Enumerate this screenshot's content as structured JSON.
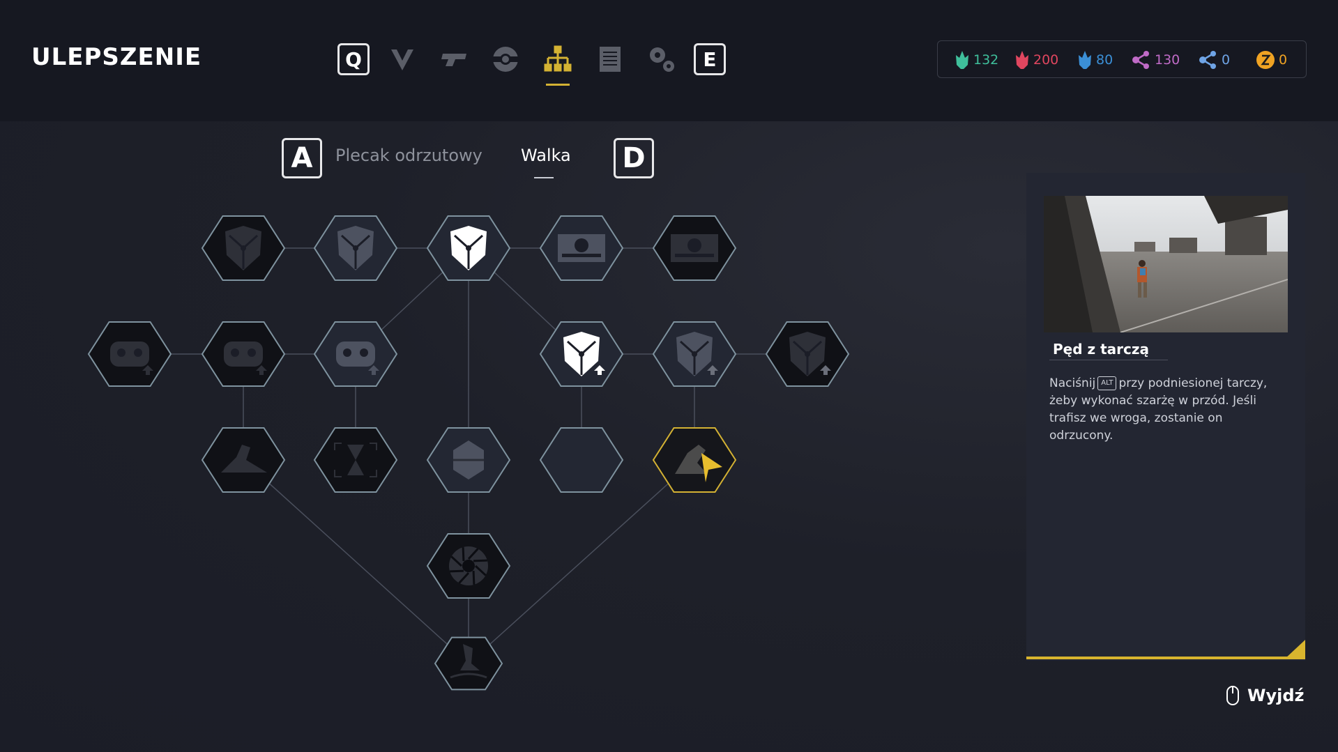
{
  "header": {
    "title": "ULEPSZENIE",
    "key_prev": "Q",
    "key_next": "E",
    "nav_icons": [
      {
        "name": "chevron-emblem-icon",
        "active": false
      },
      {
        "name": "weapon-icon",
        "active": false
      },
      {
        "name": "gear-part-icon",
        "active": false
      },
      {
        "name": "skill-tree-icon",
        "active": true
      },
      {
        "name": "document-icon",
        "active": false
      },
      {
        "name": "settings-icon",
        "active": false
      }
    ]
  },
  "resources": [
    {
      "icon": "green-crystal-icon",
      "value": "132",
      "color": "#3fbf9b"
    },
    {
      "icon": "red-crystal-icon",
      "value": "200",
      "color": "#e0465f"
    },
    {
      "icon": "blue-crystal-icon",
      "value": "80",
      "color": "#3b8fd6"
    },
    {
      "icon": "purple-node-icon",
      "value": "130",
      "color": "#c06bc7"
    },
    {
      "icon": "blue-node-icon",
      "value": "0",
      "color": "#6fa4e6"
    },
    {
      "icon": "z-coin-icon",
      "value": "0",
      "color": "#f0a323"
    }
  ],
  "subtabs": {
    "key_left": "A",
    "key_right": "D",
    "items": [
      {
        "label": "Plecak odrzutowy",
        "active": false
      },
      {
        "label": "Walka",
        "active": true
      }
    ]
  },
  "tree": {
    "nodes": [
      {
        "id": "r1c1",
        "icon": "shield-fragments-icon",
        "state": "locked"
      },
      {
        "id": "r1c2",
        "icon": "shield-fragments-upgrade-icon",
        "state": "available"
      },
      {
        "id": "r1c3",
        "icon": "shield-icon",
        "state": "unlocked"
      },
      {
        "id": "r1c4",
        "icon": "mine-icon",
        "state": "available"
      },
      {
        "id": "r1c5",
        "icon": "mine-blast-icon",
        "state": "locked"
      },
      {
        "id": "r2c0",
        "icon": "armor-upgrade-icon",
        "state": "locked"
      },
      {
        "id": "r2c1",
        "icon": "armor-upgrade-icon",
        "state": "locked"
      },
      {
        "id": "r2c2",
        "icon": "armor-upgrade-icon",
        "state": "available"
      },
      {
        "id": "r2c4",
        "icon": "shield-upgrade-icon",
        "state": "unlocked"
      },
      {
        "id": "r2c5",
        "icon": "shield-upgrade-icon",
        "state": "available"
      },
      {
        "id": "r2c6",
        "icon": "shield-upgrade-icon",
        "state": "locked"
      },
      {
        "id": "r3c1",
        "icon": "slide-icon",
        "state": "locked"
      },
      {
        "id": "r3c2",
        "icon": "hourglass-icon",
        "state": "locked"
      },
      {
        "id": "r3c3",
        "icon": "grenade-icon",
        "state": "available"
      },
      {
        "id": "r3c4",
        "icon": "honeycomb-shield-icon",
        "state": "available"
      },
      {
        "id": "r3c5",
        "icon": "shield-dash-icon",
        "state": "selected"
      },
      {
        "id": "r4c3",
        "icon": "saw-blade-icon",
        "state": "locked"
      },
      {
        "id": "r5c3",
        "icon": "ground-pound-icon",
        "state": "locked"
      }
    ]
  },
  "detail": {
    "name": "Pęd z tarczą",
    "desc_before_key": "Naciśnij",
    "key": "ALT",
    "desc_after_key": "przy podniesionej tarczy, żeby wykonać szarżę w przód. Jeśli trafisz we wroga, zostanie on odrzucony."
  },
  "footer": {
    "exit_label": "Wyjdź",
    "exit_icon": "mouse-icon"
  },
  "colors": {
    "accent": "#d4b233",
    "node_border": "#7f939f",
    "background": "#1b1d27"
  }
}
